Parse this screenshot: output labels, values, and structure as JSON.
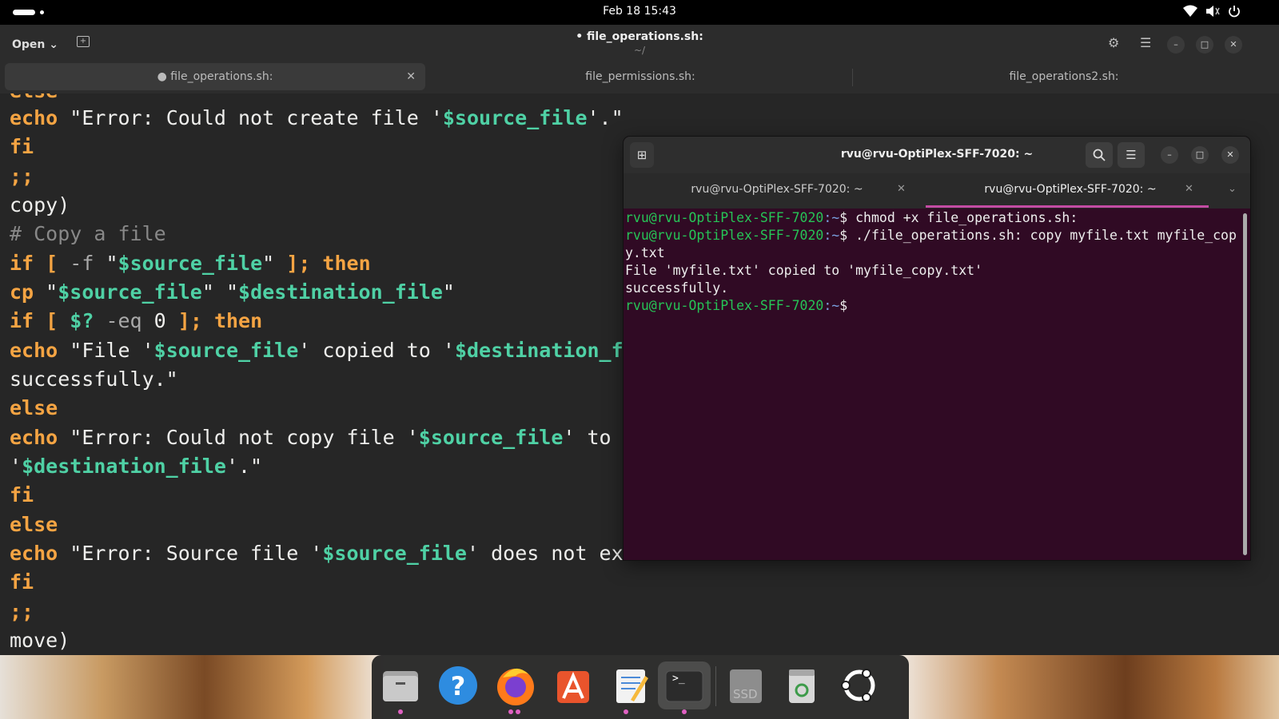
{
  "topbar": {
    "datetime": "Feb 18  15:43"
  },
  "editor": {
    "open_label": "Open",
    "title": "• file_operations.sh:",
    "subtitle": "~/",
    "tabs": [
      {
        "label": "file_operations.sh:",
        "modified": true
      },
      {
        "label": "file_permissions.sh:"
      },
      {
        "label": "file_operations2.sh:"
      }
    ]
  },
  "code": [
    "else",
    "echo \"Error: Could not create file '$source_file'.\"",
    "fi",
    ";;",
    "copy)",
    "# Copy a file",
    "if [ -f \"$source_file\" ]; then",
    "cp \"$source_file\" \"$destination_file\"",
    "if [ $? -eq 0 ]; then",
    "echo \"File '$source_file' copied to '$destination_file'",
    "successfully.\"",
    "else",
    "echo \"Error: Could not copy file '$source_file' to",
    "'$destination_file'.\"",
    "fi",
    "else",
    "echo \"Error: Source file '$source_file' does not exist.\"",
    "fi",
    ";;",
    "move)"
  ],
  "terminal": {
    "title": "rvu@rvu-OptiPlex-SFF-7020: ~",
    "tabs": [
      {
        "label": "rvu@rvu-OptiPlex-SFF-7020: ~"
      },
      {
        "label": "rvu@rvu-OptiPlex-SFF-7020: ~",
        "active": true
      }
    ],
    "prompt_user": "rvu@rvu-OptiPlex-SFF-7020",
    "prompt_path": ":~",
    "prompt_sign": "$",
    "lines": [
      {
        "cmd": " chmod +x file_operations.sh:"
      },
      {
        "cmd": " ./file_operations.sh: copy myfile.txt myfile_cop"
      },
      {
        "out": "y.txt"
      },
      {
        "out": "File 'myfile.txt' copied to 'myfile_copy.txt'"
      },
      {
        "out": "successfully."
      },
      {
        "cmd": ""
      }
    ]
  },
  "dock": {
    "apps": [
      "files-icon",
      "help-icon",
      "firefox-icon",
      "app-center-icon",
      "text-editor-icon",
      "terminal-icon",
      "ssd-icon",
      "trash-icon",
      "ubuntu-icon"
    ],
    "ssd_label": "SSD",
    "terminal_glyph": ">_"
  },
  "colors": {
    "terminal_bg": "#300a24",
    "prompt_user": "#26c456",
    "prompt_path": "#7aa0e0",
    "keyword": "#f5a443",
    "variable": "#4fd1a5",
    "accent_tab": "#c44ba4"
  }
}
